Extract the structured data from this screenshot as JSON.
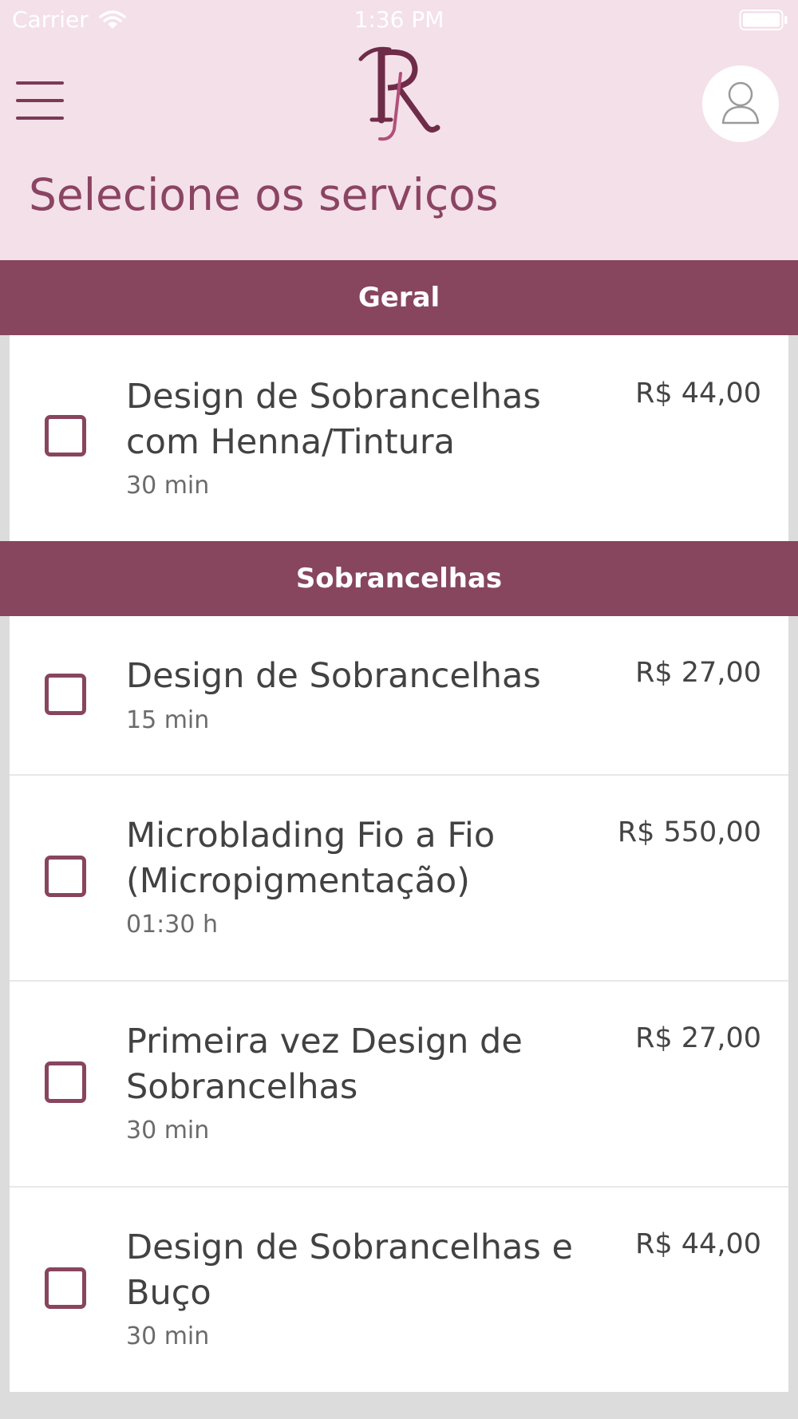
{
  "status_bar": {
    "carrier": "Carrier",
    "time": "1:36 PM"
  },
  "header": {
    "title": "Selecione os serviços"
  },
  "icons": {
    "menu": "hamburger-menu-icon",
    "logo": "rk-monogram-logo",
    "avatar": "user-avatar-icon",
    "wifi": "wifi-icon",
    "battery": "battery-icon"
  },
  "colors": {
    "header_bg": "#f4e0e9",
    "accent": "#88455e",
    "title_text": "#8b4462",
    "list_bg": "#ffffff",
    "page_bg": "#dcdcdc"
  },
  "sections": [
    {
      "title": "Geral",
      "services": [
        {
          "name": "Design de Sobrancelhas com Henna/Tintura",
          "duration": "30 min",
          "price": "R$ 44,00",
          "checked": false
        }
      ]
    },
    {
      "title": "Sobrancelhas",
      "services": [
        {
          "name": "Design de Sobrancelhas",
          "duration": "15 min",
          "price": "R$ 27,00",
          "checked": false
        },
        {
          "name": "Microblading Fio a Fio (Micropigmentação)",
          "duration": "01:30 h",
          "price": "R$ 550,00",
          "checked": false
        },
        {
          "name": "Primeira vez Design de Sobrancelhas",
          "duration": "30 min",
          "price": "R$ 27,00",
          "checked": false
        },
        {
          "name": "Design de Sobrancelhas e Buço",
          "duration": "30 min",
          "price": "R$ 44,00",
          "checked": false
        }
      ]
    }
  ]
}
